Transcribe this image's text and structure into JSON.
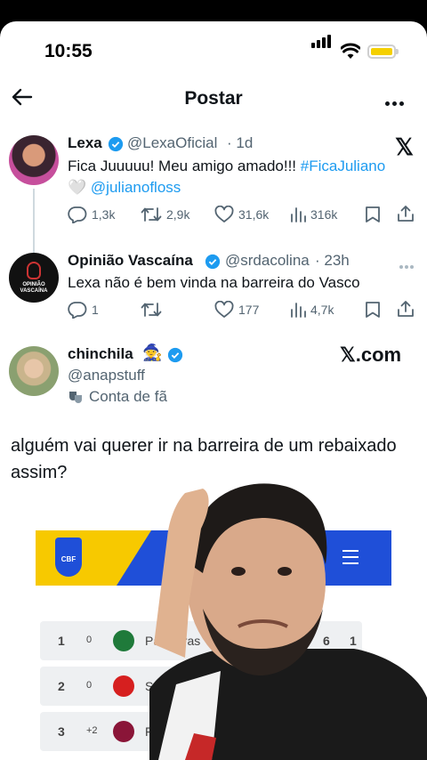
{
  "status_bar": {
    "time": "10:55"
  },
  "header": {
    "title": "Postar"
  },
  "tweets": [
    {
      "name": "Lexa",
      "handle": "@LexaOficial",
      "time": "· 1d",
      "text_plain": "Fica Juuuuu! Meu amigo amado!!! ",
      "hashtag": "#FicaJuliano",
      "heart_emoji": "🤍",
      "mention": "@julianofloss",
      "replies": "1,3k",
      "retweets": "2,9k",
      "likes": "31,6k",
      "views": "316k"
    },
    {
      "name": "Opinião Vascaína",
      "handle": "@srdacolina",
      "time": "· 23h",
      "avatar_text": "OPINIÃO VASCAÍNA",
      "text": "Lexa não é bem vinda na barreira do Vasco",
      "replies": "1",
      "retweets": "",
      "likes": "177",
      "views": "4,7k"
    }
  ],
  "quoted": {
    "name": "chinchila",
    "emoji": "🧙",
    "handle": "@anapstuff",
    "label": "Conta de fã",
    "post_text": "alguém vai querer ir na barreira de um rebaixado assim?"
  },
  "watermark": {
    "x_logo": "𝕏",
    "site": "𝕏.com"
  },
  "standings": {
    "badge": "CBF",
    "rows": [
      {
        "pos": "1",
        "change": "0",
        "team": "Palmeiras",
        "pts": "6",
        "pj": "1",
        "crest_color": "#1f7a3a"
      },
      {
        "pos": "2",
        "change": "0",
        "team": "São",
        "crest_color": "#d61f1f"
      },
      {
        "pos": "3",
        "change": "+2",
        "team": "F",
        "crest_color": "#8a1538"
      }
    ]
  },
  "colors": {
    "accent": "#1d9bf0",
    "muted": "#536471",
    "verified": "#1d9bf0"
  }
}
